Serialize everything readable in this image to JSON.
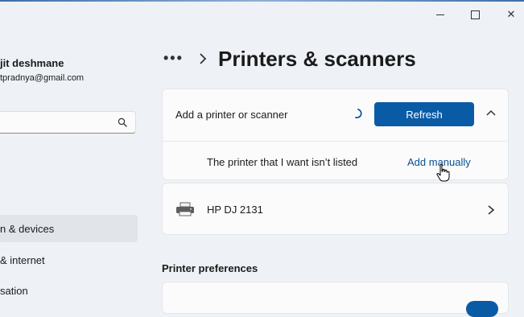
{
  "window": {
    "minimize_icon": "minimize-icon",
    "maximize_icon": "maximize-icon",
    "close_icon": "close-icon",
    "close_glyph": "✕"
  },
  "sidebar": {
    "user_name": "jit deshmane",
    "user_email": "tpradnya@gmail.com",
    "search_icon": "search-icon",
    "items": [
      {
        "label": "n & devices",
        "active": true
      },
      {
        "label": "& internet",
        "active": false
      },
      {
        "label": "sation",
        "active": false
      }
    ]
  },
  "header": {
    "more_label": "•••",
    "title": "Printers & scanners"
  },
  "add_section": {
    "label": "Add a printer or scanner",
    "refresh_label": "Refresh",
    "not_listed_label": "The printer that I want isn’t listed",
    "add_manually_label": "Add manually"
  },
  "printers": [
    {
      "name": "HP DJ 2131",
      "icon": "printer-icon"
    }
  ],
  "preferences": {
    "title": "Printer preferences"
  },
  "colors": {
    "accent": "#0a5ba6",
    "link": "#0a4f94",
    "background": "#eef1f6",
    "card": "#fbfbfb"
  }
}
